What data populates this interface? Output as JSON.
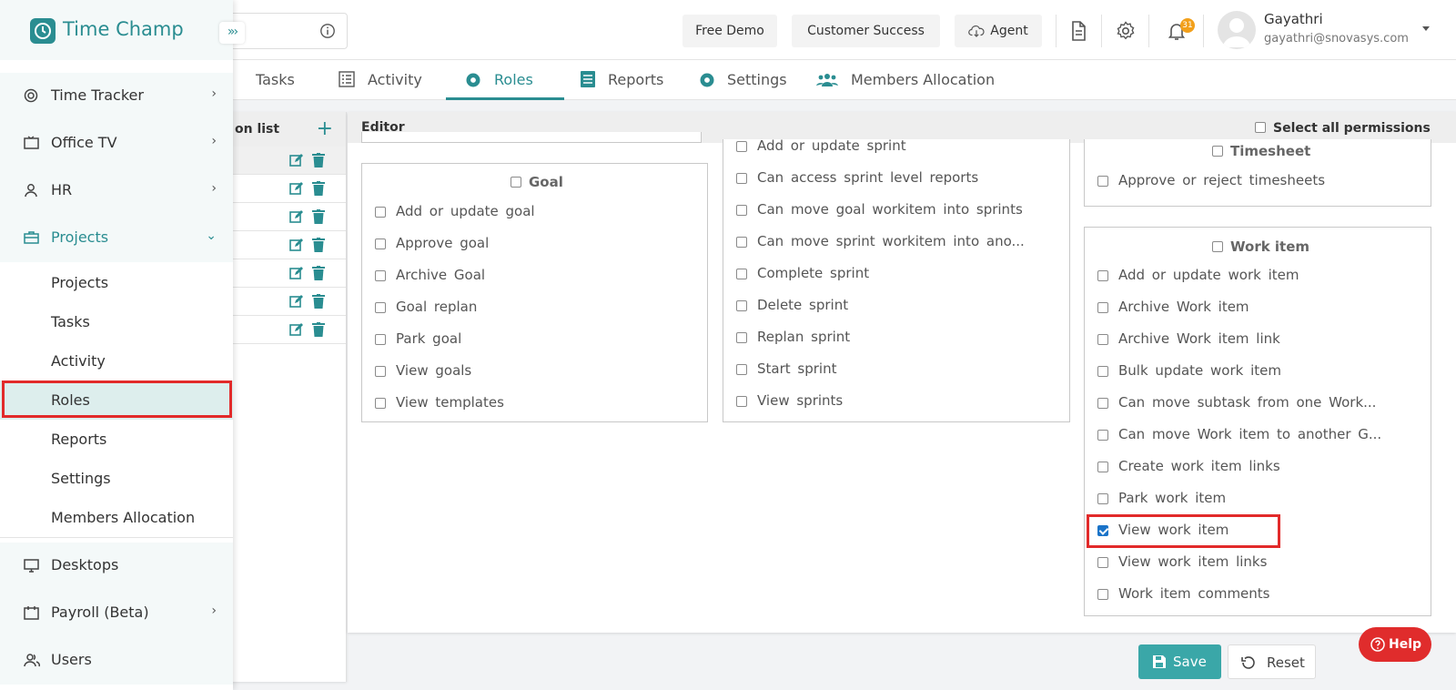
{
  "brand": {
    "title": "Time Champ"
  },
  "header": {
    "free_demo": "Free Demo",
    "customer_success": "Customer Success",
    "agent": "Agent",
    "notification_count": "31",
    "user_name": "Gayathri",
    "user_email": "gayathri@snovasys.com"
  },
  "sidebar": {
    "items": [
      {
        "label": "Time Tracker"
      },
      {
        "label": "Office TV"
      },
      {
        "label": "HR"
      },
      {
        "label": "Projects"
      },
      {
        "label": "Desktops"
      },
      {
        "label": "Payroll (Beta)"
      },
      {
        "label": "Users"
      }
    ],
    "subitems": [
      {
        "label": "Projects"
      },
      {
        "label": "Tasks"
      },
      {
        "label": "Activity"
      },
      {
        "label": "Roles"
      },
      {
        "label": "Reports"
      },
      {
        "label": "Settings"
      },
      {
        "label": "Members Allocation"
      }
    ]
  },
  "tabs": [
    {
      "label": "Tasks"
    },
    {
      "label": "Activity"
    },
    {
      "label": "Roles"
    },
    {
      "label": "Reports"
    },
    {
      "label": "Settings"
    },
    {
      "label": "Members Allocation"
    }
  ],
  "rolelist": {
    "title": "on list"
  },
  "editor": {
    "title": "Editor",
    "select_all": "Select all permissions",
    "goal": {
      "title": "Goal",
      "perms": [
        "Add or update goal",
        "Approve goal",
        "Archive Goal",
        "Goal replan",
        "Park goal",
        "View goals",
        "View templates"
      ]
    },
    "sprint": {
      "perms": [
        "Add or update sprint",
        "Can access sprint level reports",
        "Can move goal workitem into sprints",
        "Can move sprint workitem into ano...",
        "Complete sprint",
        "Delete sprint",
        "Replan sprint",
        "Start sprint",
        "View sprints"
      ]
    },
    "timesheet": {
      "title": "Timesheet",
      "perms": [
        "Approve or reject timesheets"
      ]
    },
    "workitem": {
      "title": "Work item",
      "perms": [
        "Add or update work item",
        "Archive Work item",
        "Archive Work item link",
        "Bulk update work item",
        "Can move subtask from one Work...",
        "Can move Work item to another G...",
        "Create work item links",
        "Park work item",
        "View work item",
        "View work item links",
        "Work item comments"
      ]
    }
  },
  "footer": {
    "save": "Save",
    "reset": "Reset",
    "help": "Help"
  },
  "colors": {
    "accent": "#2a8d91",
    "highlight": "#e22a2a",
    "save": "#3aa7a8",
    "help": "#e02c2c"
  }
}
